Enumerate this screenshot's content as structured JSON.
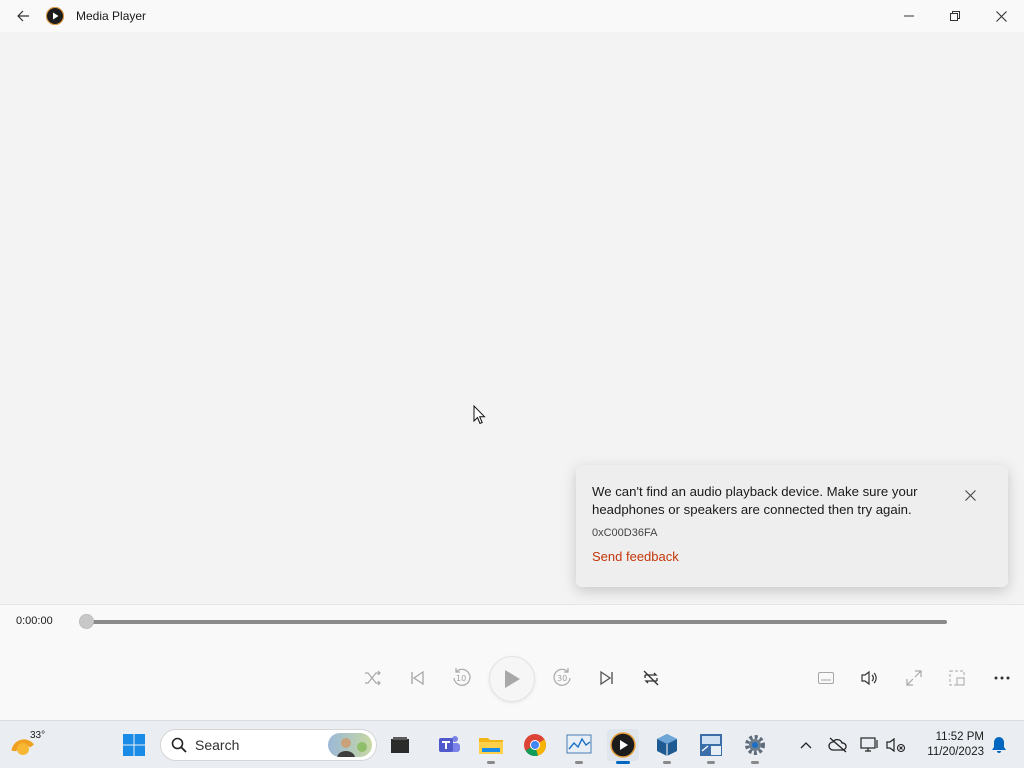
{
  "window": {
    "title": "Media Player"
  },
  "toast": {
    "message": "We can't find an audio playback device. Make sure your headphones or speakers are connected then try again.",
    "error_code": "0xC00D36FA",
    "link_label": "Send feedback"
  },
  "player": {
    "current_time": "0:00:00",
    "progress": 0,
    "skip_back_seconds": "10",
    "skip_forward_seconds": "30"
  },
  "taskbar": {
    "weather_temp": "33°",
    "search_placeholder": "Search",
    "apps": [
      "widgets",
      "start",
      "search",
      "file-manager",
      "teams",
      "file-explorer",
      "chrome",
      "resource-monitor",
      "media-player",
      "virtualbox",
      "hex-editor",
      "settings"
    ]
  },
  "clock": {
    "time": "11:52 PM",
    "date": "11/20/2023"
  },
  "colors": {
    "accent_link": "#c4370a",
    "taskbar_active": "#0067c0"
  }
}
